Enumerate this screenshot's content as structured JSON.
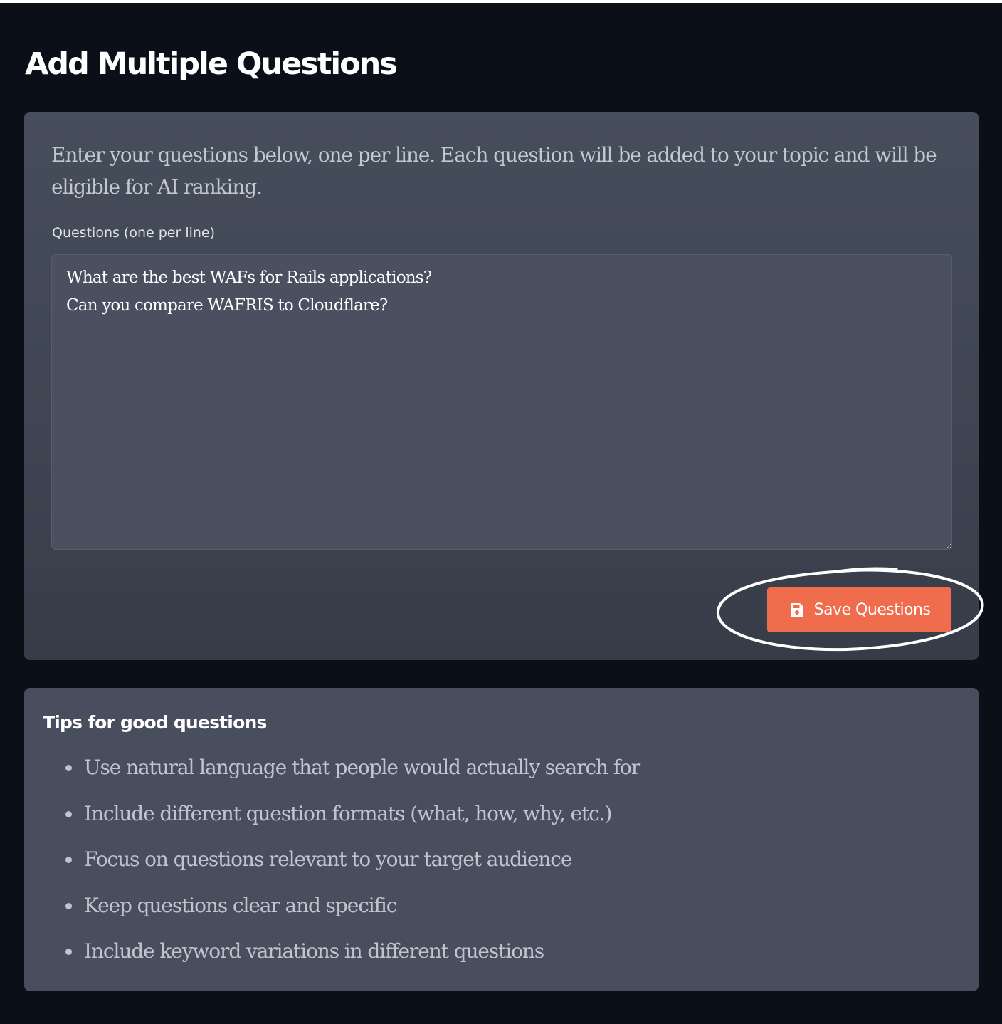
{
  "page": {
    "title": "Add Multiple Questions"
  },
  "form": {
    "intro": "Enter your questions below, one per line. Each question will be added to your topic and will be eligible for AI ranking.",
    "field_label": "Questions (one per line)",
    "textarea_value": "What are the best WAFs for Rails applications?\nCan you compare WAFRIS to Cloudflare?",
    "save_label": "Save Questions",
    "save_icon": "floppy-disk-icon"
  },
  "tips": {
    "title": "Tips for good questions",
    "items": [
      "Use natural language that people would actually search for",
      "Include different question formats (what, how, why, etc.)",
      "Focus on questions relevant to your target audience",
      "Keep questions clear and specific",
      "Include keyword variations in different questions"
    ]
  },
  "colors": {
    "background": "#0a0f18",
    "card": "#464d5b",
    "textarea": "#4a5060",
    "accent": "#ef6c4d",
    "annotation": "#ffffff"
  }
}
